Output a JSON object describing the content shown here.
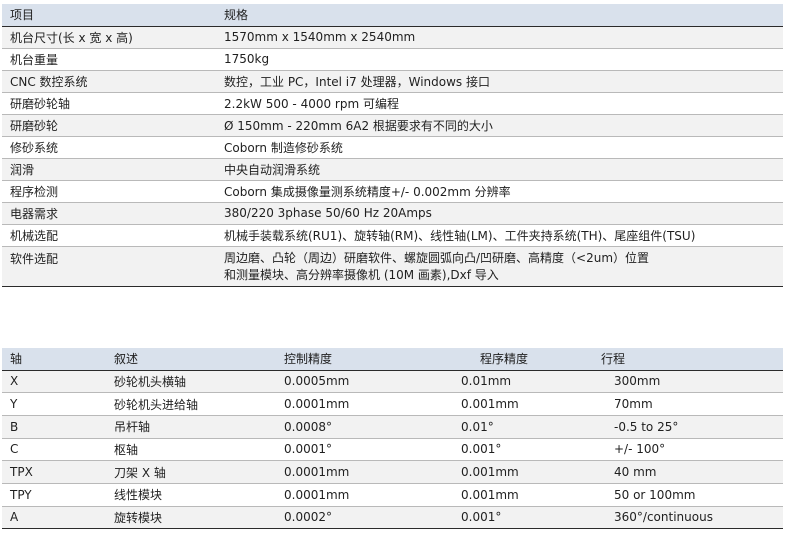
{
  "spec_table": {
    "headers": {
      "item": "项目",
      "spec": "规格"
    },
    "rows": [
      {
        "item": "机台尺寸(长 x 宽 x 高)",
        "spec": [
          "1570mm x 1540mm x 2540mm"
        ]
      },
      {
        "item": "机台重量",
        "spec": [
          "1750kg"
        ]
      },
      {
        "item": "CNC 数控系统",
        "spec": [
          "数控，工业 PC，Intel i7 处理器，Windows 接口"
        ]
      },
      {
        "item": "研磨砂轮轴",
        "spec": [
          "2.2kW 500 - 4000 rpm 可编程"
        ]
      },
      {
        "item": "研磨砂轮",
        "spec": [
          "Ø 150mm - 220mm 6A2 根据要求有不同的大小"
        ]
      },
      {
        "item": "修砂系统",
        "spec": [
          "Coborn 制造修砂系统"
        ]
      },
      {
        "item": "润滑",
        "spec": [
          "中央自动润滑系统"
        ]
      },
      {
        "item": "程序检测",
        "spec": [
          "Coborn 集成摄像量测系统精度+/- 0.002mm 分辨率"
        ]
      },
      {
        "item": "电器需求",
        "spec": [
          "380/220 3phase 50/60 Hz 20Amps"
        ]
      },
      {
        "item": "机械选配",
        "spec": [
          "机械手装载系统(RU1)、旋转轴(RM)、线性轴(LM)、工件夹持系统(TH)、尾座组件(TSU)"
        ]
      },
      {
        "item": "软件选配",
        "spec": [
          "周边磨、凸轮（周边）研磨软件、螺旋圆弧向凸/凹研磨、高精度（<2um）位置",
          "和测量模块、高分辨率摄像机 (10M 画素),Dxf 导入"
        ]
      }
    ]
  },
  "axis_table": {
    "headers": {
      "axis": "轴",
      "desc": "叙述",
      "control": "控制精度",
      "program": "程序精度",
      "travel": "行程"
    },
    "rows": [
      {
        "axis": "X",
        "desc": "砂轮机头横轴",
        "control": "0.0005mm",
        "program": "0.01mm",
        "travel": "300mm"
      },
      {
        "axis": "Y",
        "desc": "砂轮机头进给轴",
        "control": "0.0001mm",
        "program": "0.001mm",
        "travel": "70mm"
      },
      {
        "axis": "B",
        "desc": "吊杆轴",
        "control": "0.0008°",
        "program": "0.01°",
        "travel": "-0.5 to 25°"
      },
      {
        "axis": "C",
        "desc": "枢轴",
        "control": "0.0001°",
        "program": "0.001°",
        "travel": "+/- 100°"
      },
      {
        "axis": "TPX",
        "desc": "刀架 X 轴",
        "control": "0.0001mm",
        "program": "0.001mm",
        "travel": "40 mm"
      },
      {
        "axis": "TPY",
        "desc": "线性模块",
        "control": "0.0001mm",
        "program": "0.001mm",
        "travel": "50 or 100mm"
      },
      {
        "axis": "A",
        "desc": "旋转模块",
        "control": "0.0002°",
        "program": "0.001°",
        "travel": "360°/continuous"
      }
    ]
  }
}
